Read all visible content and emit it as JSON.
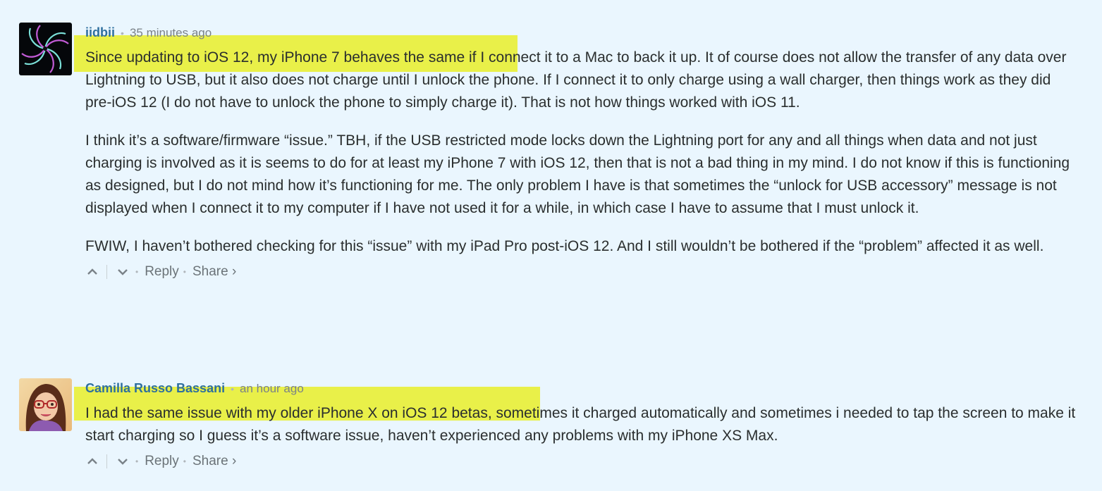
{
  "comments": [
    {
      "author": "iidbii",
      "time": "35 minutes ago",
      "paragraphs": [
        {
          "highlight": "Since updating to iOS 12, my iPhone 7 behaves the same i",
          "rest": "f I connect it to a Mac to back it up. It of course does not allow the transfer of any data over Lightning to USB, but it also does not charge until I unlock the phone. If I connect it to only charge using a wall charger, then things work as they did pre-iOS 12 (I do not have to unlock the phone to simply charge it). That is not how things worked with iOS 11."
        },
        {
          "text": "I think it’s a software/firmware “issue.” TBH, if the USB restricted mode locks down the Lightning port for any and all things when data and not just charging is involved as it is seems to do for at least my iPhone 7 with iOS 12, then that is not a bad thing in my mind. I do not know if this is functioning as designed, but I do not mind how it’s functioning for me. The only problem I have is that sometimes the “unlock for USB accessory” message is not displayed when I connect it to my computer if I have not used it for a while, in which case I have to assume that I must unlock it."
        },
        {
          "text": "FWIW, I haven’t bothered checking for this “issue” with my iPad Pro post-iOS 12. And I still wouldn’t be bothered if the “problem” affected it as well."
        }
      ],
      "reply_label": "Reply",
      "share_label": "Share ›"
    },
    {
      "author": "Camilla Russo Bassani",
      "time": "an hour ago",
      "paragraphs": [
        {
          "highlight": "I had the same issue with my older iPhone X on iOS 12 betas,",
          "rest": " sometimes it charged automatically and sometimes i needed to tap the screen to make it start charging so I guess it’s a software issue, haven’t experienced any problems with my iPhone XS Max."
        }
      ],
      "reply_label": "Reply",
      "share_label": "Share ›"
    }
  ],
  "icons": {
    "upvote": "chevron-up-icon",
    "downvote": "chevron-down-icon"
  },
  "colors": {
    "background": "#eaf6fe",
    "author": "#2e6f9e",
    "highlight": "#e9f049",
    "meta": "#7a8288"
  }
}
